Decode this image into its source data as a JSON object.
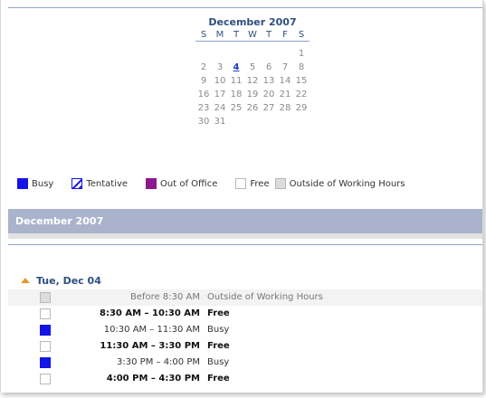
{
  "mini_calendar": {
    "title": "December 2007",
    "weekdays": [
      "S",
      "M",
      "T",
      "W",
      "T",
      "F",
      "S"
    ],
    "weeks": [
      [
        "",
        "",
        "",
        "",
        "",
        "",
        "1"
      ],
      [
        "2",
        "3",
        "4",
        "5",
        "6",
        "7",
        "8"
      ],
      [
        "9",
        "10",
        "11",
        "12",
        "13",
        "14",
        "15"
      ],
      [
        "16",
        "17",
        "18",
        "19",
        "20",
        "21",
        "22"
      ],
      [
        "23",
        "24",
        "25",
        "26",
        "27",
        "28",
        "29"
      ],
      [
        "30",
        "31",
        "",
        "",
        "",
        "",
        ""
      ]
    ],
    "selected_day": "4"
  },
  "legend": {
    "busy": "Busy",
    "tentative": "Tentative",
    "out_of_office": "Out of Office",
    "free": "Free",
    "outside": "Outside of Working Hours"
  },
  "colors": {
    "busy": "#1414e6",
    "out_of_office": "#8b1a8f",
    "outside": "#dcdcdc",
    "banner": "#a9b4cc",
    "accent": "#2f4f80"
  },
  "month_banner": "December 2007",
  "day": {
    "header": "Tue, Dec 04",
    "slots": [
      {
        "time": "Before 8:30 AM",
        "status": "Outside of Working Hours",
        "kind": "outside"
      },
      {
        "time": "8:30 AM – 10:30 AM",
        "status": "Free",
        "kind": "free"
      },
      {
        "time": "10:30 AM – 11:30 AM",
        "status": "Busy",
        "kind": "busy"
      },
      {
        "time": "11:30 AM – 3:30 PM",
        "status": "Free",
        "kind": "free"
      },
      {
        "time": "3:30 PM – 4:00 PM",
        "status": "Busy",
        "kind": "busy"
      },
      {
        "time": "4:00 PM – 4:30 PM",
        "status": "Free",
        "kind": "free"
      }
    ]
  }
}
